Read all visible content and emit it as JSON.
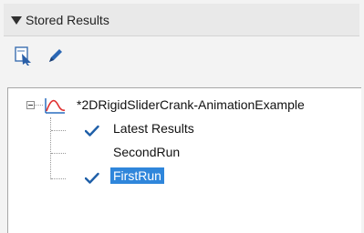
{
  "panel": {
    "title": "Stored Results"
  },
  "toolbar": {
    "icons": [
      "import-results-icon",
      "edit-pencil-icon"
    ]
  },
  "tree": {
    "model_name": "*2DRigidSliderCrank-AnimationExample",
    "items": [
      {
        "label": "Latest Results",
        "checked": true,
        "selected": false
      },
      {
        "label": "SecondRun",
        "checked": false,
        "selected": false
      },
      {
        "label": "FirstRun",
        "checked": true,
        "selected": true
      }
    ]
  },
  "colors": {
    "selection": "#2f86db",
    "check": "#1f5fa8",
    "model_icon_curve": "#e03030",
    "model_icon_axis": "#2a6dbf"
  }
}
